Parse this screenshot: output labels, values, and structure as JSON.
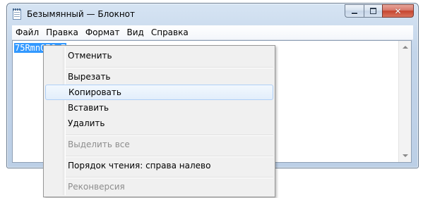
{
  "window": {
    "title": "Безымянный — Блокнот",
    "icon": "notepad-icon",
    "controls": {
      "minimize_icon": "minimize-icon",
      "maximize_icon": "maximize-icon",
      "close_glyph": "✕"
    }
  },
  "menubar": {
    "items": [
      {
        "label": "Файл"
      },
      {
        "label": "Правка"
      },
      {
        "label": "Формат"
      },
      {
        "label": "Вид"
      },
      {
        "label": "Справка"
      }
    ]
  },
  "editor": {
    "selected_text": "75RmnQ7Gn7"
  },
  "context_menu": {
    "items": [
      {
        "label": "Отменить",
        "enabled": true
      },
      {
        "label": "Вырезать",
        "enabled": true
      },
      {
        "label": "Копировать",
        "enabled": true,
        "highlighted": true
      },
      {
        "label": "Вставить",
        "enabled": true
      },
      {
        "label": "Удалить",
        "enabled": true
      },
      {
        "label": "Выделить все",
        "enabled": false
      },
      {
        "label": "Порядок чтения: справа налево",
        "enabled": true
      },
      {
        "label": "Реконверсия",
        "enabled": false
      }
    ]
  },
  "colors": {
    "selection": "#3399ff",
    "menu_background": "#f0f0f0",
    "highlight_border": "#aecff7",
    "disabled_text": "#8d8d8d"
  }
}
